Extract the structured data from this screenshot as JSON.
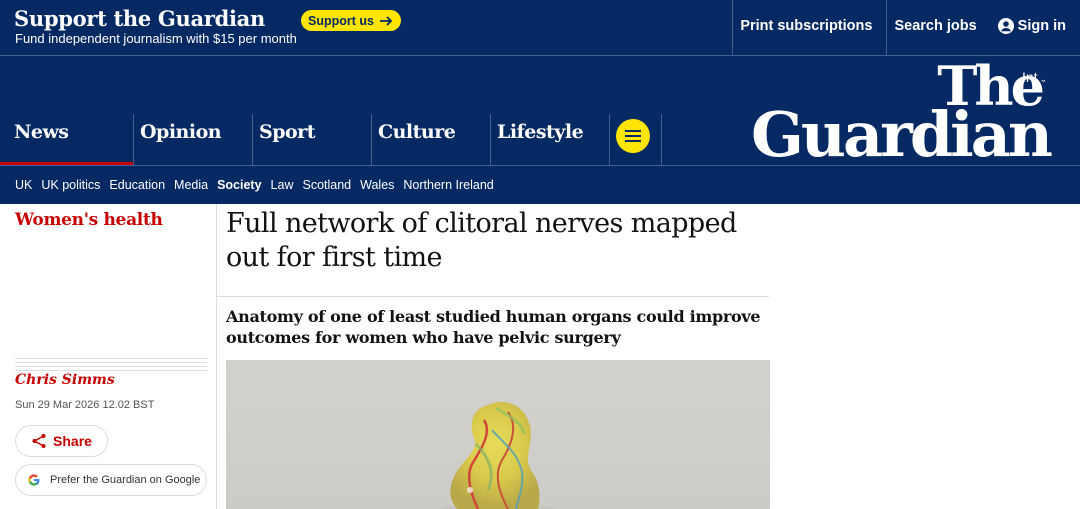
{
  "support": {
    "title": "Support the Guardian",
    "subtitle": "Fund independent journalism with $15 per month",
    "button_label": "Support us"
  },
  "top_links": {
    "print": "Print subscriptions",
    "jobs": "Search jobs",
    "signin": "Sign in"
  },
  "edition": "Int",
  "logo": {
    "line1": "The",
    "line2": "Guardian"
  },
  "pillars": [
    "News",
    "Opinion",
    "Sport",
    "Culture",
    "Lifestyle"
  ],
  "subnav": [
    "UK",
    "UK politics",
    "Education",
    "Media",
    "Society",
    "Law",
    "Scotland",
    "Wales",
    "Northern Ireland"
  ],
  "article": {
    "section": "Women's health",
    "headline": "Full network of clitoral nerves mapped out for first time",
    "standfirst": "Anatomy of one of least studied human organs could improve outcomes for women who have pelvic surgery",
    "byline": "Chris Simms",
    "date": "Sun 29 Mar 2026 12.02 BST",
    "share_label": "Share",
    "google_label": "Prefer the Guardian on Google"
  },
  "colors": {
    "brand_blue": "#052962",
    "support_yellow": "#ffe500",
    "news_red": "#c70000"
  }
}
